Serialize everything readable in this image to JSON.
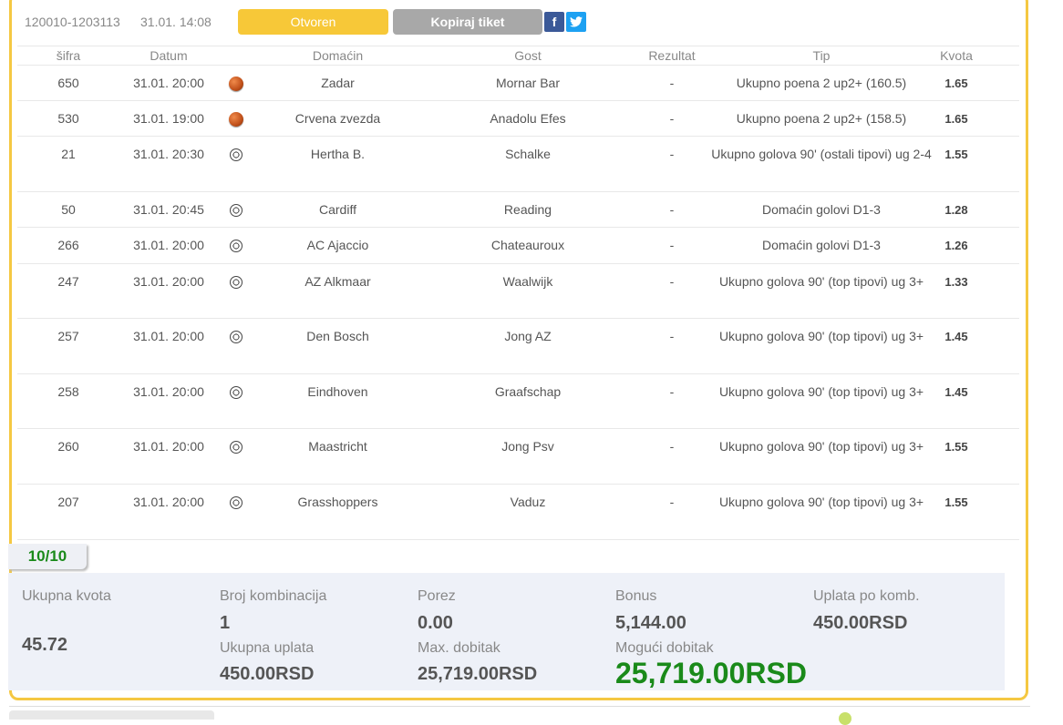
{
  "ticket": {
    "id": "120010-1203113",
    "time": "31.01. 14:08",
    "status_label": "Otvoren",
    "copy_label": "Kopiraj tiket",
    "facebook": "f",
    "twitter": "t"
  },
  "columns": {
    "sifra": "šifra",
    "datum": "Datum",
    "domacin": "Domaćin",
    "gost": "Gost",
    "rezultat": "Rezultat",
    "tip": "Tip",
    "kvota": "Kvota"
  },
  "rows": [
    {
      "sifra": "650",
      "datum": "31.01. 20:00",
      "sport": "basketball-icon",
      "domacin": "Zadar",
      "gost": "Mornar Bar",
      "rezultat": "-",
      "tip": "Ukupno poena 2 up2+ (160.5)",
      "kvota": "1.65"
    },
    {
      "sifra": "530",
      "datum": "31.01. 19:00",
      "sport": "basketball-icon",
      "domacin": "Crvena zvezda",
      "gost": "Anadolu Efes",
      "rezultat": "-",
      "tip": "Ukupno poena 2 up2+ (158.5)",
      "kvota": "1.65"
    },
    {
      "sifra": "21",
      "datum": "31.01. 20:30",
      "sport": "soccer-ball-icon",
      "domacin": "Hertha B.",
      "gost": "Schalke",
      "rezultat": "-",
      "tip": "Ukupno golova 90' (ostali tipovi) ug 2-4",
      "kvota": "1.55"
    },
    {
      "sifra": "50",
      "datum": "31.01. 20:45",
      "sport": "soccer-ball-icon",
      "domacin": "Cardiff",
      "gost": "Reading",
      "rezultat": "-",
      "tip": "Domaćin golovi D1-3",
      "kvota": "1.28"
    },
    {
      "sifra": "266",
      "datum": "31.01. 20:00",
      "sport": "soccer-ball-icon",
      "domacin": "AC Ajaccio",
      "gost": "Chateauroux",
      "rezultat": "-",
      "tip": "Domaćin golovi D1-3",
      "kvota": "1.26"
    },
    {
      "sifra": "247",
      "datum": "31.01. 20:00",
      "sport": "soccer-ball-icon",
      "domacin": "AZ Alkmaar",
      "gost": "Waalwijk",
      "rezultat": "-",
      "tip": "Ukupno golova 90' (top tipovi) ug 3+",
      "kvota": "1.33"
    },
    {
      "sifra": "257",
      "datum": "31.01. 20:00",
      "sport": "soccer-ball-icon",
      "domacin": "Den Bosch",
      "gost": "Jong AZ",
      "rezultat": "-",
      "tip": "Ukupno golova 90' (top tipovi) ug 3+",
      "kvota": "1.45"
    },
    {
      "sifra": "258",
      "datum": "31.01. 20:00",
      "sport": "soccer-ball-icon",
      "domacin": "Eindhoven",
      "gost": "Graafschap",
      "rezultat": "-",
      "tip": "Ukupno golova 90' (top tipovi) ug 3+",
      "kvota": "1.45"
    },
    {
      "sifra": "260",
      "datum": "31.01. 20:00",
      "sport": "soccer-ball-icon",
      "domacin": "Maastricht",
      "gost": "Jong Psv",
      "rezultat": "-",
      "tip": "Ukupno golova 90' (top tipovi) ug 3+",
      "kvota": "1.55"
    },
    {
      "sifra": "207",
      "datum": "31.01. 20:00",
      "sport": "soccer-ball-icon",
      "domacin": "Grasshoppers",
      "gost": "Vaduz",
      "rezultat": "-",
      "tip": "Ukupno golova 90' (top tipovi) ug 3+",
      "kvota": "1.55"
    }
  ],
  "count": "10/10",
  "summary": {
    "ukupna_kvota_label": "Ukupna kvota",
    "ukupna_kvota": "45.72",
    "broj_kombinacija_label": "Broj kombinacija",
    "broj_kombinacija": "1",
    "ukupna_uplata_label": "Ukupna uplata",
    "ukupna_uplata": "450.00RSD",
    "porez_label": "Porez",
    "porez": "0.00",
    "max_dobitak_label": "Max. dobitak",
    "max_dobitak": "25,719.00RSD",
    "bonus_label": "Bonus",
    "bonus": "5,144.00",
    "moguci_dobitak_label": "Mogući dobitak",
    "moguci_dobitak": "25,719.00RSD",
    "uplata_po_komb_label": "Uplata po komb.",
    "uplata_po_komb": "450.00RSD"
  },
  "colors": {
    "border": "#f5c842",
    "status_button": "#f7c838",
    "copy_button": "#a8a8a8",
    "win_green": "#1a8a1a"
  }
}
